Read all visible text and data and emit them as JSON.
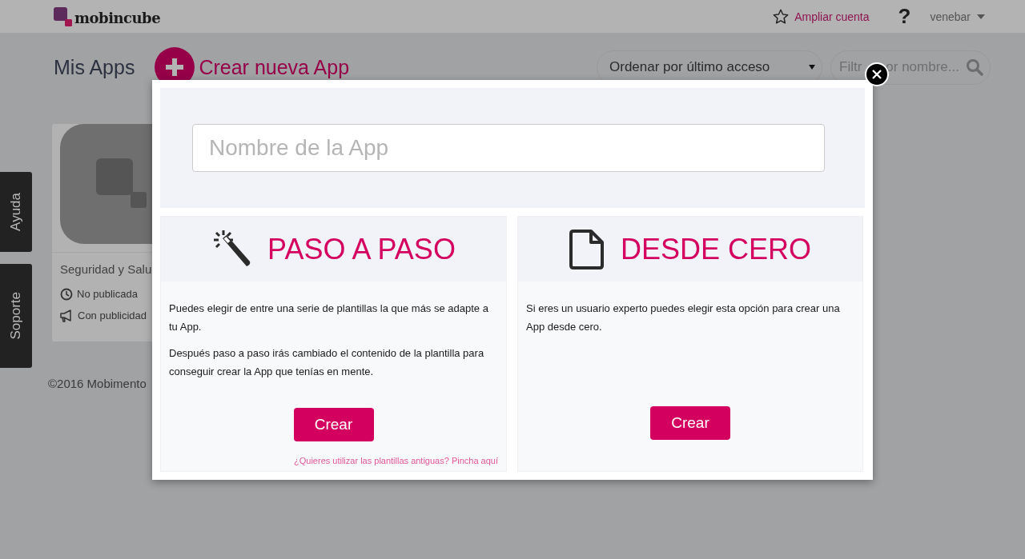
{
  "header": {
    "logo_text": "mobincube",
    "upgrade_link": "Ampliar cuenta",
    "help": "?",
    "user_menu": "venebar"
  },
  "toolbar": {
    "title": "Mis Apps",
    "create_button": "Crear nueva App",
    "sort_select": "Ordenar por último acceso",
    "filter": {
      "visible_text": [
        "Filtr",
        "or nombre..."
      ]
    }
  },
  "side_tabs": [
    "Ayuda",
    "Soporte"
  ],
  "app_card": {
    "name": "Seguridad y Salu",
    "status": [
      {
        "kind": "clock",
        "text": "No publicada"
      },
      {
        "kind": "megaphone",
        "text": "Con publicidad"
      }
    ]
  },
  "footer": "©2016 Mobimento",
  "modal": {
    "name_field": {
      "placeholder": "Nombre de la App"
    },
    "options": [
      {
        "kind": "wizard",
        "title": "PASO A PASO",
        "paragraphs": [
          "Puedes elegir de entre una serie de plantillas la que más se adapte a tu App.",
          "Después paso a paso irás cambiado el contenido de la plantilla para conseguir crear la App que tenías en mente."
        ],
        "button": "Crear",
        "link": "¿Quieres utilizar las plantillas antiguas? Pincha aquí"
      },
      {
        "kind": "file",
        "title": "DESDE CERO",
        "paragraphs": [
          "Si eres un usuario experto puedes elegir esta opción para crear una App desde cero."
        ],
        "button": "Crear"
      }
    ]
  }
}
